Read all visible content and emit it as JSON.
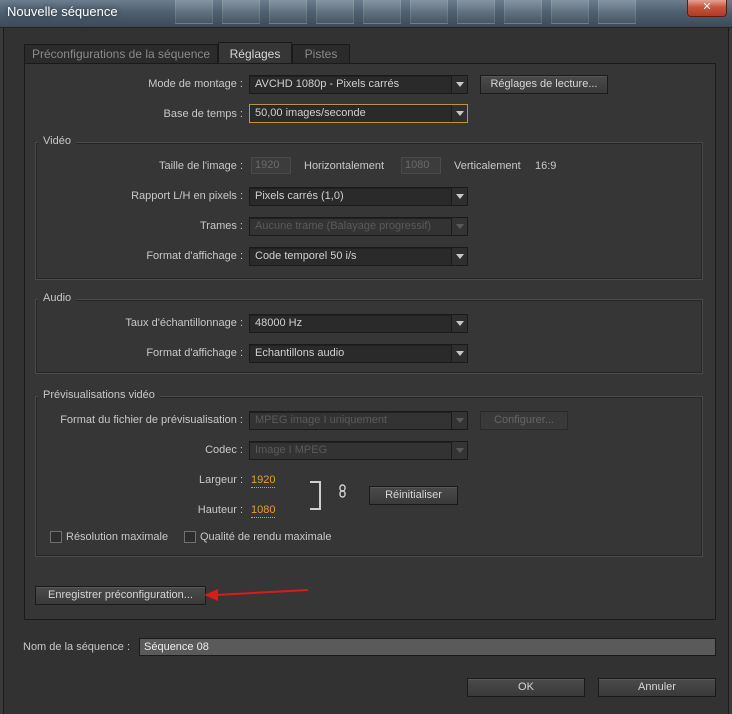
{
  "window": {
    "title": "Nouvelle séquence",
    "close_glyph": "✕"
  },
  "tabs": [
    {
      "label": "Préconfigurations de la séquence",
      "active": false
    },
    {
      "label": "Réglages",
      "active": true
    },
    {
      "label": "Pistes",
      "active": false
    }
  ],
  "settings": {
    "editing_mode_label": "Mode de montage :",
    "editing_mode_value": "AVCHD 1080p - Pixels carrés",
    "playback_button": "Réglages de lecture...",
    "timebase_label": "Base de temps :",
    "timebase_value": "50,00 images/seconde"
  },
  "video": {
    "title": "Vidéo",
    "frame_size_label": "Taille de l'image :",
    "width_value": "1920",
    "horizontal_label": "Horizontalement",
    "height_value": "1080",
    "vertical_label": "Verticalement",
    "aspect": "16:9",
    "pixel_aspect_label": "Rapport L/H en pixels :",
    "pixel_aspect_value": "Pixels carrés (1,0)",
    "fields_label": "Trames :",
    "fields_value": "Aucune trame (Balayage progressif)",
    "display_format_label": "Format d'affichage :",
    "display_format_value": "Code temporel 50 i/s"
  },
  "audio": {
    "title": "Audio",
    "sample_rate_label": "Taux d'échantillonnage :",
    "sample_rate_value": "48000 Hz",
    "display_format_label": "Format d'affichage :",
    "display_format_value": "Echantillons audio"
  },
  "preview": {
    "title": "Prévisualisations vidéo",
    "file_format_label": "Format du fichier de prévisualisation :",
    "file_format_value": "MPEG image I uniquement",
    "configure_button": "Configurer...",
    "codec_label": "Codec :",
    "codec_value": "Image I MPEG",
    "width_label": "Largeur :",
    "width_value": "1920",
    "height_label": "Hauteur :",
    "height_value": "1080",
    "reset_button": "Réinitialiser",
    "max_resolution_label": "Résolution maximale",
    "max_quality_label": "Qualité de rendu maximale"
  },
  "save_preset_button": "Enregistrer préconfiguration...",
  "sequence_name_label": "Nom de la séquence :",
  "sequence_name_value": "Séquence 08",
  "ok_button": "OK",
  "cancel_button": "Annuler",
  "colors": {
    "accent_hot_text": "#e3a030",
    "annotation_arrow": "#e01818",
    "focus_border": "#c0962e"
  }
}
